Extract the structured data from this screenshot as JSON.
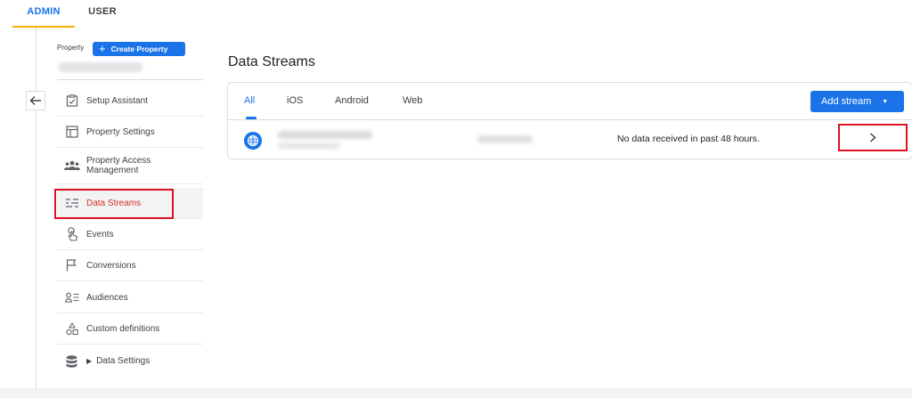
{
  "top_tabs": {
    "admin": "ADMIN",
    "user": "USER"
  },
  "property": {
    "label": "Property",
    "create_button": "Create Property",
    "create_icon": "+"
  },
  "nav": {
    "items": [
      {
        "label": "Setup Assistant",
        "icon": "checklist-icon"
      },
      {
        "label": "Property Settings",
        "icon": "settings-panel-icon"
      },
      {
        "label": "Property Access Management",
        "icon": "people-icon"
      },
      {
        "label": "Data Streams",
        "icon": "streams-icon",
        "active": true
      },
      {
        "label": "Events",
        "icon": "touch-icon"
      },
      {
        "label": "Conversions",
        "icon": "flag-icon"
      },
      {
        "label": "Audiences",
        "icon": "audience-icon"
      },
      {
        "label": "Custom definitions",
        "icon": "shapes-icon"
      },
      {
        "label": "Data Settings",
        "icon": "database-icon"
      }
    ]
  },
  "main": {
    "title": "Data Streams",
    "tabs": [
      "All",
      "iOS",
      "Android",
      "Web"
    ],
    "active_tab": "All",
    "add_stream_label": "Add stream",
    "add_stream_caret": "▼",
    "stream": {
      "status": "No data received in past 48 hours.",
      "chevron": "›"
    }
  },
  "colors": {
    "accent": "#1a73e8",
    "admin_underline": "#f4b400",
    "highlight": "#e01020",
    "active_nav_text": "#d93025"
  }
}
